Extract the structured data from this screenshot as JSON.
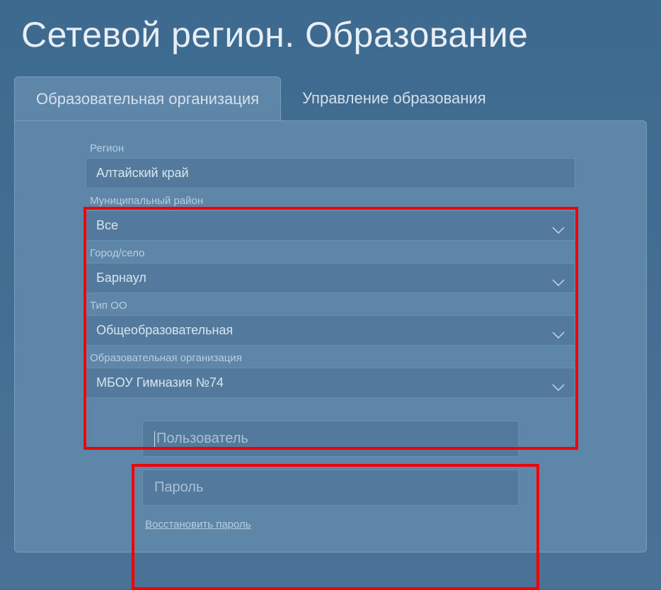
{
  "header": {
    "title": "Сетевой регион. Образование"
  },
  "tabs": [
    {
      "label": "Образовательная организация",
      "active": true
    },
    {
      "label": "Управление образования",
      "active": false
    }
  ],
  "form": {
    "region": {
      "label": "Регион",
      "value": "Алтайский край"
    },
    "district": {
      "label": "Муниципальный район",
      "value": "Все"
    },
    "city": {
      "label": "Город/село",
      "value": "Барнаул"
    },
    "type": {
      "label": "Тип ОО",
      "value": "Общеобразовательная"
    },
    "org": {
      "label": "Образовательная организация",
      "value": "МБОУ Гимназия №74"
    }
  },
  "credentials": {
    "user_placeholder": "Пользователь",
    "password_placeholder": "Пароль",
    "restore_label": "Восстановить пароль"
  }
}
